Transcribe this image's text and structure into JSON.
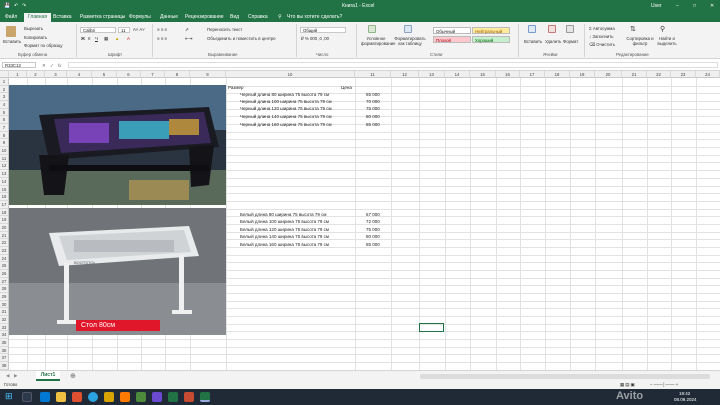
{
  "window": {
    "title": "Книга1 - Excel",
    "search_placeholder": "Что вы хотите сделать?",
    "user": "User"
  },
  "tabs": [
    "Файл",
    "Главная",
    "Вставка",
    "Разметка страницы",
    "Формулы",
    "Данные",
    "Рецензирование",
    "Вид",
    "Справка"
  ],
  "ribbon": {
    "paste": "Вставить",
    "cut": "Вырезать",
    "copy": "Копировать",
    "format_painter": "Формат по образцу",
    "clipboard_group": "Буфер обмена",
    "font_name": "Calibri",
    "font_size": "11",
    "font_group": "Шрифт",
    "wrap_text": "Переносить текст",
    "merge_center": "Объединить и поместить в центре",
    "alignment_group": "Выравнивание",
    "number_format": "Общий",
    "number_group": "Число",
    "conditional_formatting": "Условное форматирование",
    "format_as_table": "Форматировать как таблицу",
    "styles": {
      "normal": "Обычный",
      "neutral": "Нейтральный",
      "bad": "Плохой",
      "good": "Хороший"
    },
    "styles_group": "Стили",
    "insert": "Вставить",
    "delete": "Удалить",
    "format": "Формат",
    "cells_group": "Ячейки",
    "autosum": "Автосумма",
    "fill": "Заполнить",
    "clear": "Очистить",
    "sort_filter": "Сортировка и фильтр",
    "find_select": "Найти и выделить",
    "editing_group": "Редактирование"
  },
  "formula_bar": {
    "name_box": "R33C13",
    "fx": "fx",
    "value": ""
  },
  "columns": [
    "1",
    "2",
    "3",
    "4",
    "5",
    "6",
    "7",
    "8",
    "9",
    "10",
    "11",
    "12",
    "13",
    "14",
    "15",
    "16",
    "17",
    "18",
    "19",
    "20",
    "21",
    "22",
    "23",
    "24"
  ],
  "rows": [
    "1",
    "2",
    "3",
    "4",
    "5",
    "6",
    "7",
    "8",
    "9",
    "10",
    "11",
    "12",
    "13",
    "14",
    "15",
    "16",
    "17",
    "18",
    "19",
    "20",
    "21",
    "22",
    "23",
    "24",
    "25",
    "26",
    "27",
    "28",
    "29",
    "30",
    "31",
    "32",
    "33",
    "34",
    "35",
    "36",
    "37",
    "38"
  ],
  "sheet": {
    "header_size": "Размер",
    "header_price": "Цена",
    "black": [
      {
        "size": "Черный длина 80 ширина 75 высота 79 см",
        "price": "65 000"
      },
      {
        "size": "Черный длина 100 ширина 75 высота 79 см",
        "price": "70 000"
      },
      {
        "size": "Черный длина 120 ширина 75 высота 79 см",
        "price": "75 000"
      },
      {
        "size": "Черный длина 140 ширина 75 высота 79 см",
        "price": "80 000"
      },
      {
        "size": "Черный длина 160 ширина 75 высота 79 см",
        "price": "85 000"
      }
    ],
    "white": [
      {
        "size": "Белый длина 80 ширина 75 высота 79 см",
        "price": "67 000"
      },
      {
        "size": "Белый длина 100 ширина 75 высота 79 см",
        "price": "72 000"
      },
      {
        "size": "Белый длина 120 ширина 75 высота 79 см",
        "price": "75 000"
      },
      {
        "size": "Белый длина 140 ширина 75 высота 79 см",
        "price": "80 000"
      },
      {
        "size": "Белый длина 160 ширина 75 высота 79 см",
        "price": "85 000"
      }
    ],
    "photo_label": "Стол 80см",
    "photo_brand": "BOOTSTOL"
  },
  "sheet_tab": "Лист1",
  "status": "Готово",
  "clock": {
    "time": "19:42",
    "date": "08.09.2024"
  },
  "watermark": "Avito",
  "colors": {
    "excel_green": "#217346",
    "label_red": "#e0162b",
    "taskbar": "#1f2a36"
  }
}
